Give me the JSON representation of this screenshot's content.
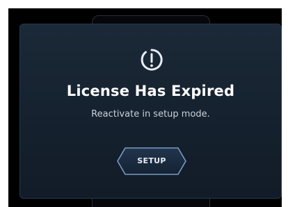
{
  "dialog": {
    "icon": "alert-circle-icon",
    "title": "License Has Expired",
    "message": "Reactivate in setup mode.",
    "button_label": "SETUP"
  },
  "colors": {
    "screen_background": "#000000",
    "dialog_background": "#172433",
    "title_text": "#ffffff",
    "message_text": "#c9d1da",
    "button_border": "#7a9bc4",
    "button_fill": "#1a2a3f"
  }
}
